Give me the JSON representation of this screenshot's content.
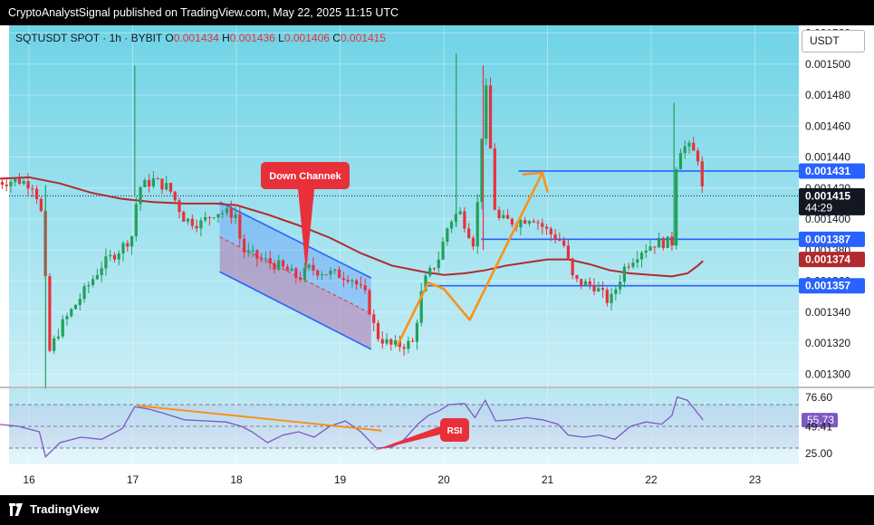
{
  "header": {
    "publish_line": "CryptoAnalystSignal published on TradingView.com, May 22, 2025 11:15 UTC"
  },
  "footer": {
    "brand": "TradingView"
  },
  "currency_button": "USDT",
  "colors": {
    "up": "#22a05a",
    "down": "#e8303a",
    "ma": "#b2292e",
    "level_line": "#2962ff",
    "channel": "#2962ff",
    "arrow": "#f7931a",
    "bg_top": "#6fd3e6",
    "bg_bottom": "#c9eef6"
  },
  "chart_data": {
    "type": "candlestick",
    "symbol_line": {
      "symbol": "SQTUSDT SPOT · 1h · BYBIT",
      "o_label": "O",
      "o": "0.001434",
      "h_label": "H",
      "h": "0.001436",
      "l_label": "L",
      "l": "0.001406",
      "c_label": "C",
      "c": "0.001415"
    },
    "price_axis": {
      "ticks": [
        "0.001300",
        "0.001320",
        "0.001340",
        "0.001360",
        "0.001380",
        "0.001400",
        "0.001420",
        "0.001440",
        "0.001460",
        "0.001480",
        "0.001500",
        "0.001520"
      ],
      "ylim": [
        0.001292,
        0.001525
      ]
    },
    "time_axis": {
      "ticks": [
        "16",
        "17",
        "18",
        "19",
        "20",
        "21",
        "22",
        "23"
      ]
    },
    "price_labels": [
      {
        "text": "0.001431",
        "value": 0.001431,
        "style": "blue"
      },
      {
        "text": "0.001415",
        "value": 0.001415,
        "style": "black",
        "sub": "44:29"
      },
      {
        "text": "0.001387",
        "value": 0.001387,
        "style": "blue"
      },
      {
        "text": "0.001374",
        "value": 0.001374,
        "style": "red"
      },
      {
        "text": "0.001357",
        "value": 0.001357,
        "style": "blue"
      }
    ],
    "horizontal_levels": [
      {
        "value": 0.001431,
        "from": 20.72,
        "to": 23.45
      },
      {
        "value": 0.001387,
        "from": 20.36,
        "to": 23.45
      },
      {
        "value": 0.001357,
        "from": 19.84,
        "to": 23.45
      }
    ],
    "current_price": 0.001415,
    "down_channel": {
      "label": "Down Channek",
      "upper": [
        [
          17.84,
          0.001411
        ],
        [
          19.3,
          0.001362
        ]
      ],
      "lower": [
        [
          17.84,
          0.001366
        ],
        [
          19.3,
          0.001316
        ]
      ]
    },
    "orange_path": [
      [
        19.55,
        0.001318
      ],
      [
        19.85,
        0.001359
      ],
      [
        20.0,
        0.001355
      ],
      [
        20.25,
        0.001335
      ],
      [
        20.95,
        0.00143
      ]
    ],
    "moving_average": [
      [
        15.7,
        0.001426
      ],
      [
        16.0,
        0.001427
      ],
      [
        16.3,
        0.001423
      ],
      [
        16.6,
        0.001417
      ],
      [
        16.9,
        0.001413
      ],
      [
        17.2,
        0.001411
      ],
      [
        17.5,
        0.00141
      ],
      [
        17.8,
        0.00141
      ],
      [
        18.0,
        0.001409
      ],
      [
        18.3,
        0.001403
      ],
      [
        18.6,
        0.001396
      ],
      [
        18.9,
        0.001388
      ],
      [
        19.2,
        0.001378
      ],
      [
        19.5,
        0.00137
      ],
      [
        19.8,
        0.001366
      ],
      [
        20.0,
        0.001364
      ],
      [
        20.2,
        0.001365
      ],
      [
        20.4,
        0.001367
      ],
      [
        20.6,
        0.00137
      ],
      [
        20.8,
        0.001372
      ],
      [
        21.0,
        0.001374
      ],
      [
        21.2,
        0.001374
      ],
      [
        21.4,
        0.001371
      ],
      [
        21.6,
        0.001367
      ],
      [
        21.8,
        0.001365
      ],
      [
        22.0,
        0.001364
      ],
      [
        22.2,
        0.001363
      ],
      [
        22.35,
        0.001365
      ],
      [
        22.45,
        0.00137
      ],
      [
        22.5,
        0.001373
      ]
    ],
    "close_points": [
      [
        15.7,
        0.001424
      ],
      [
        15.9,
        0.001425
      ],
      [
        16.05,
        0.001422
      ],
      [
        16.15,
        0.001395
      ],
      [
        16.17,
        0.00131
      ],
      [
        16.3,
        0.00133
      ],
      [
        16.5,
        0.00135
      ],
      [
        16.7,
        0.00137
      ],
      [
        16.9,
        0.001382
      ],
      [
        17.0,
        0.00139
      ],
      [
        17.05,
        0.00142
      ],
      [
        17.2,
        0.001425
      ],
      [
        17.35,
        0.00142
      ],
      [
        17.5,
        0.0014
      ],
      [
        17.65,
        0.001397
      ],
      [
        17.8,
        0.001405
      ],
      [
        18.0,
        0.001403
      ],
      [
        18.05,
        0.00138
      ],
      [
        18.2,
        0.001375
      ],
      [
        18.4,
        0.00137
      ],
      [
        18.6,
        0.001362
      ],
      [
        18.7,
        0.001368
      ],
      [
        18.9,
        0.001365
      ],
      [
        19.1,
        0.001363
      ],
      [
        19.25,
        0.00135
      ],
      [
        19.35,
        0.001325
      ],
      [
        19.5,
        0.001318
      ],
      [
        19.7,
        0.00132
      ],
      [
        19.8,
        0.001358
      ],
      [
        19.95,
        0.001375
      ],
      [
        20.05,
        0.001398
      ],
      [
        20.15,
        0.001405
      ],
      [
        20.3,
        0.001383
      ],
      [
        20.4,
        0.00149
      ],
      [
        20.5,
        0.0014
      ],
      [
        20.7,
        0.001398
      ],
      [
        20.85,
        0.001402
      ],
      [
        21.0,
        0.001392
      ],
      [
        21.15,
        0.001385
      ],
      [
        21.25,
        0.00136
      ],
      [
        21.45,
        0.001357
      ],
      [
        21.6,
        0.001346
      ],
      [
        21.75,
        0.00137
      ],
      [
        21.9,
        0.00138
      ],
      [
        22.05,
        0.001385
      ],
      [
        22.2,
        0.001385
      ],
      [
        22.25,
        0.001445
      ],
      [
        22.35,
        0.001447
      ],
      [
        22.45,
        0.00144
      ],
      [
        22.5,
        0.001415
      ]
    ],
    "wicks": [
      [
        16.16,
        0.001422,
        0.001291
      ],
      [
        17.02,
        0.001499,
        0.001415
      ],
      [
        20.12,
        0.001507,
        0.001395
      ],
      [
        20.38,
        0.001499,
        0.00138
      ],
      [
        22.22,
        0.001475,
        0.001383
      ]
    ],
    "rsi": {
      "label": "RSI",
      "ylim": [
        15,
        85
      ],
      "levels": [
        {
          "text": "76.60",
          "value": 76.6
        },
        {
          "text": "55.73",
          "value": 55.73,
          "style": "purple"
        },
        {
          "text": "49.41",
          "value": 49.41
        },
        {
          "text": "25.00",
          "value": 25.0
        }
      ],
      "dashed_levels": [
        70,
        50,
        30
      ],
      "values": [
        [
          15.7,
          52
        ],
        [
          15.9,
          50
        ],
        [
          16.1,
          45
        ],
        [
          16.16,
          22
        ],
        [
          16.3,
          35
        ],
        [
          16.5,
          40
        ],
        [
          16.7,
          38
        ],
        [
          16.9,
          48
        ],
        [
          17.02,
          68
        ],
        [
          17.15,
          66
        ],
        [
          17.3,
          62
        ],
        [
          17.5,
          56
        ],
        [
          17.7,
          55
        ],
        [
          17.9,
          54
        ],
        [
          18.05,
          50
        ],
        [
          18.15,
          45
        ],
        [
          18.3,
          35
        ],
        [
          18.45,
          42
        ],
        [
          18.6,
          45
        ],
        [
          18.75,
          40
        ],
        [
          18.9,
          50
        ],
        [
          19.05,
          55
        ],
        [
          19.2,
          45
        ],
        [
          19.35,
          30
        ],
        [
          19.5,
          31
        ],
        [
          19.6,
          36
        ],
        [
          19.75,
          52
        ],
        [
          19.85,
          60
        ],
        [
          19.95,
          64
        ],
        [
          20.05,
          70
        ],
        [
          20.2,
          71
        ],
        [
          20.3,
          58
        ],
        [
          20.4,
          74
        ],
        [
          20.5,
          55
        ],
        [
          20.65,
          56
        ],
        [
          20.8,
          58
        ],
        [
          20.95,
          56
        ],
        [
          21.1,
          52
        ],
        [
          21.2,
          42
        ],
        [
          21.35,
          40
        ],
        [
          21.5,
          42
        ],
        [
          21.65,
          38
        ],
        [
          21.8,
          50
        ],
        [
          21.95,
          54
        ],
        [
          22.1,
          52
        ],
        [
          22.2,
          60
        ],
        [
          22.25,
          77
        ],
        [
          22.35,
          74
        ],
        [
          22.45,
          62
        ],
        [
          22.5,
          56
        ]
      ],
      "divergence_line": [
        [
          17.05,
          69
        ],
        [
          19.4,
          46
        ]
      ],
      "rsi_arrow": [
        [
          19.4,
          30
        ],
        [
          19.95,
          50
        ]
      ]
    }
  }
}
